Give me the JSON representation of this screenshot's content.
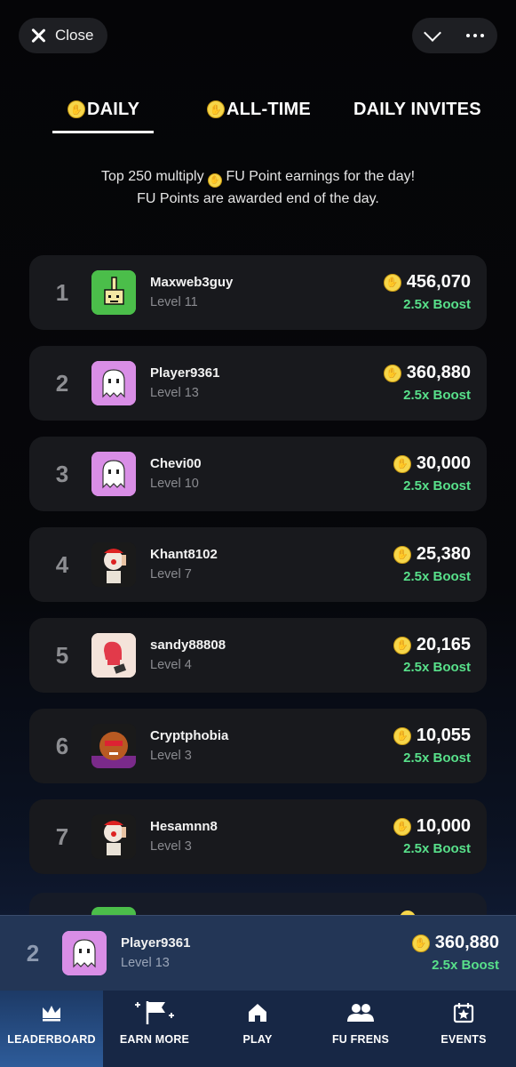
{
  "topbar": {
    "close_label": "Close"
  },
  "tabs": [
    {
      "label": "DAILY",
      "active": true
    },
    {
      "label": "ALL-TIME",
      "active": false
    },
    {
      "label": "DAILY INVITES",
      "active": false
    }
  ],
  "subtitle": {
    "line1_before": "Top 250 multiply",
    "line1_after": "FU Point earnings for the day!",
    "line2": "FU Points are awarded end of the day."
  },
  "leaderboard": [
    {
      "rank": "1",
      "name": "Maxweb3guy",
      "level": "Level 11",
      "points": "456,070",
      "boost": "2.5x Boost",
      "avatar": "pixel-hand"
    },
    {
      "rank": "2",
      "name": "Player9361",
      "level": "Level 13",
      "points": "360,880",
      "boost": "2.5x Boost",
      "avatar": "ghost"
    },
    {
      "rank": "3",
      "name": "Chevi00",
      "level": "Level 10",
      "points": "30,000",
      "boost": "2.5x Boost",
      "avatar": "ghost"
    },
    {
      "rank": "4",
      "name": "Khant8102",
      "level": "Level 7",
      "points": "25,380",
      "boost": "2.5x Boost",
      "avatar": "clown"
    },
    {
      "rank": "5",
      "name": "sandy88808",
      "level": "Level 4",
      "points": "20,165",
      "boost": "2.5x Boost",
      "avatar": "glove"
    },
    {
      "rank": "6",
      "name": "Cryptphobia",
      "level": "Level 3",
      "points": "10,055",
      "boost": "2.5x Boost",
      "avatar": "hairy"
    },
    {
      "rank": "7",
      "name": "Hesamnn8",
      "level": "Level 3",
      "points": "10,000",
      "boost": "2.5x Boost",
      "avatar": "clown"
    }
  ],
  "pinned": {
    "rank": "2",
    "name": "Player9361",
    "level": "Level 13",
    "points": "360,880",
    "boost": "2.5x Boost"
  },
  "nav": [
    {
      "label": "LEADERBOARD",
      "icon": "crown-icon",
      "active": true
    },
    {
      "label": "EARN MORE",
      "icon": "flag-icon",
      "active": false
    },
    {
      "label": "PLAY",
      "icon": "home-icon",
      "active": false
    },
    {
      "label": "FU FRENS",
      "icon": "friends-icon",
      "active": false
    },
    {
      "label": "EVENTS",
      "icon": "calendar-star-icon",
      "active": false
    }
  ],
  "colors": {
    "boost": "#58e08a",
    "coin": "#f6d64a",
    "card": "#18191d",
    "pinned": "#233656"
  }
}
